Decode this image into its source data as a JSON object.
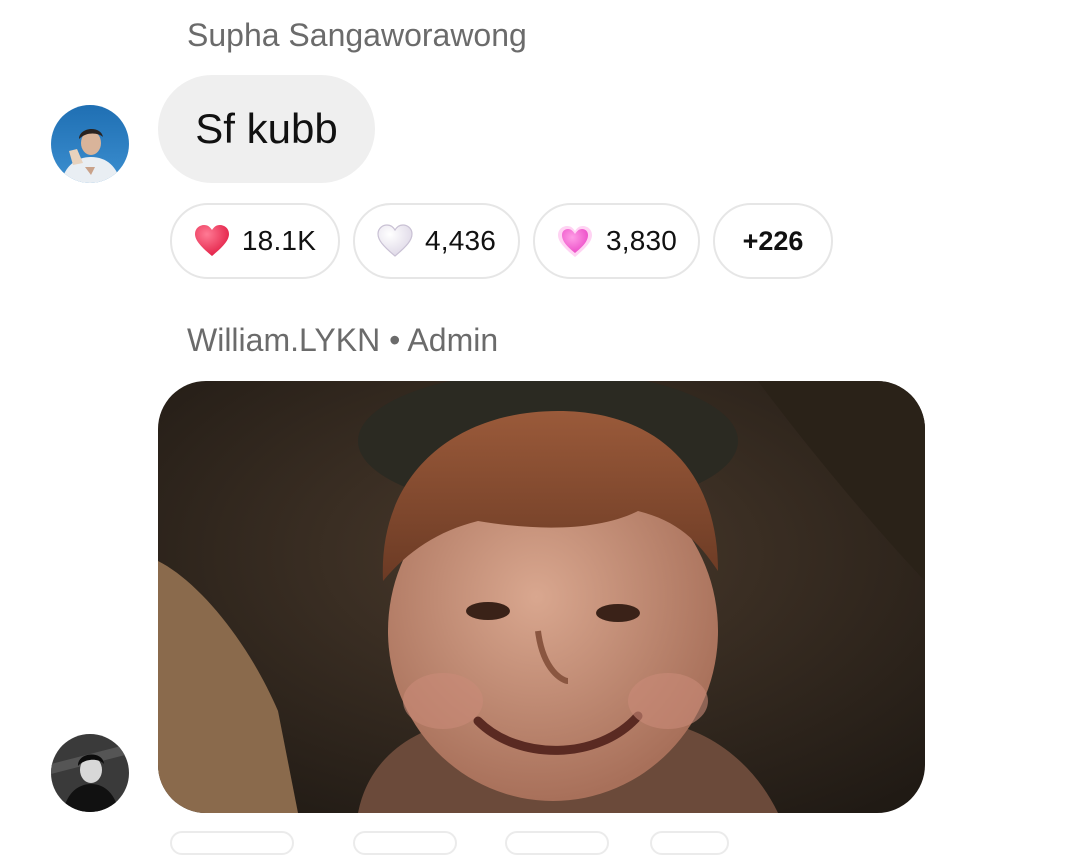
{
  "messages": [
    {
      "sender": "Supha Sangaworawong",
      "text": "Sf kubb",
      "avatar_icon": "profile-photo-icon"
    },
    {
      "sender": "William.LYKN • Admin",
      "media": "gif-image",
      "avatar_icon": "profile-photo-icon"
    }
  ],
  "reactions": [
    {
      "icon": "red-heart-icon",
      "count": "18.1K",
      "color": "#e8244f"
    },
    {
      "icon": "white-heart-icon",
      "count": "4,436",
      "color": "#f2eef6"
    },
    {
      "icon": "pink-sparkling-heart-icon",
      "count": "3,830",
      "color": "#f25bd0"
    },
    {
      "label": "+226"
    }
  ]
}
